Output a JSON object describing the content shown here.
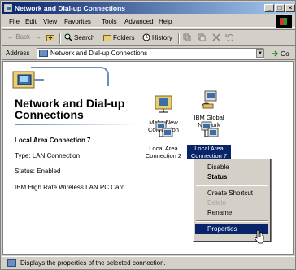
{
  "window": {
    "title": "Network and Dial-up Connections"
  },
  "titlebar": {
    "min": "_",
    "max": "□",
    "close": "×"
  },
  "menubar": {
    "items": [
      "File",
      "Edit",
      "View",
      "Favorites",
      "Tools",
      "Advanced",
      "Help"
    ]
  },
  "toolbar": {
    "back": "← Back",
    "forward": "→",
    "search": "Search",
    "folders": "Folders",
    "history": "History"
  },
  "address": {
    "label": "Address",
    "value": "Network and Dial-up Connections",
    "go": "Go"
  },
  "leftpane": {
    "title": "Network and Dial-up Connections",
    "selected_name": "Local Area Connection 7",
    "type": "Type: LAN Connection",
    "status": "Status: Enabled",
    "device": "IBM High Rate Wireless LAN PC Card"
  },
  "icons": [
    {
      "label": "Make New Connection",
      "icon": "make-new-connection-icon",
      "selected": false
    },
    {
      "label": "IBM Global Network",
      "icon": "dialup-connection-icon",
      "selected": false
    },
    {
      "label": "Local Area Connection 2",
      "icon": "lan-connection-icon",
      "selected": false
    },
    {
      "label": "Local Area Connection 7",
      "icon": "lan-connection-icon",
      "selected": true
    }
  ],
  "context_menu": {
    "disable": "Disable",
    "status": "Status",
    "create_shortcut": "Create Shortcut",
    "delete": "Delete",
    "rename": "Rename",
    "properties": "Properties"
  },
  "statusbar": {
    "text": "Displays the properties of the selected connection."
  },
  "colors": {
    "selection": "#0a246a",
    "chrome": "#d4d0c8",
    "titlebar": "#0a246a"
  }
}
